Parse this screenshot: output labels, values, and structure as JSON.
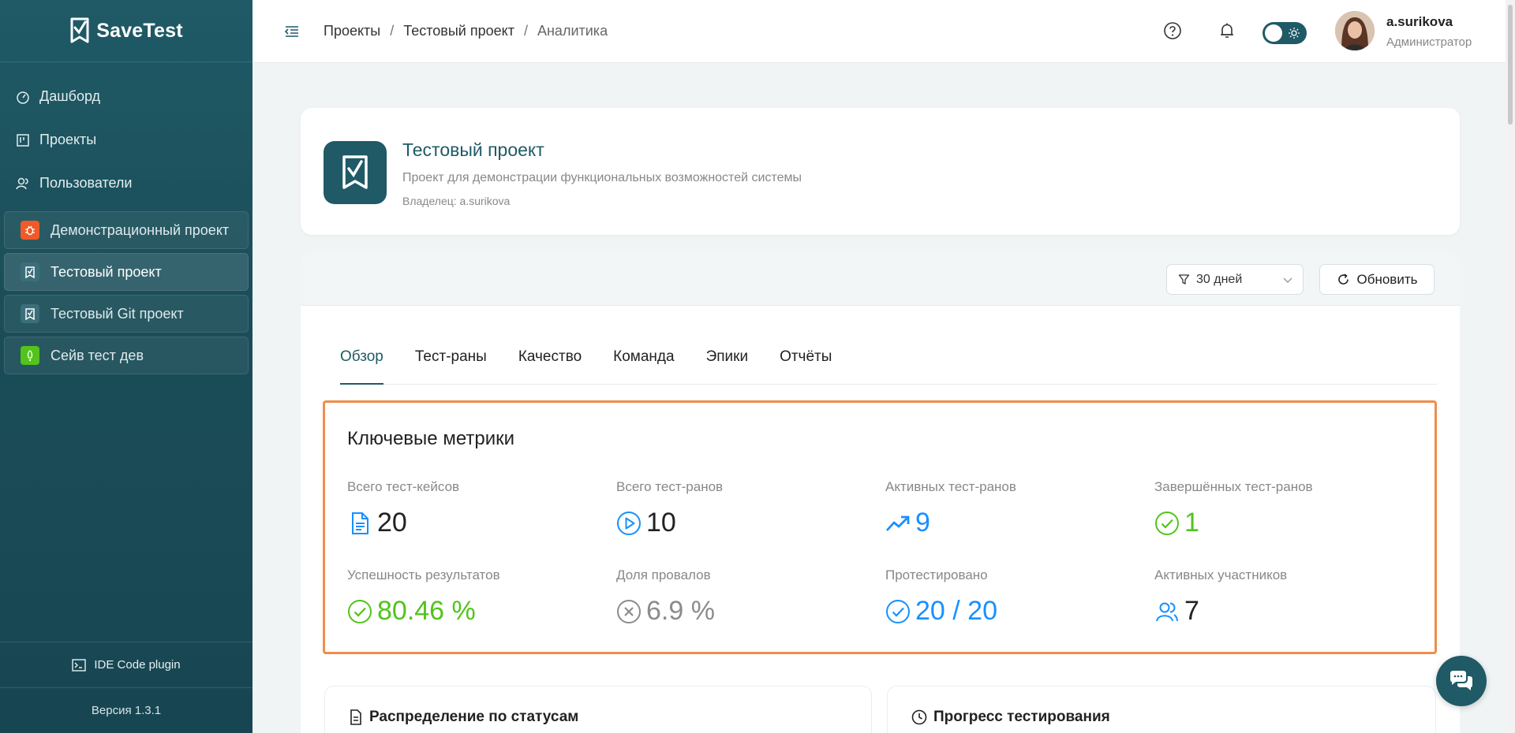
{
  "brand": {
    "name": "SaveTest"
  },
  "sidebar": {
    "nav": [
      {
        "label": "Дашборд",
        "icon": "dashboard-icon"
      },
      {
        "label": "Проекты",
        "icon": "projects-icon"
      },
      {
        "label": "Пользователи",
        "icon": "users-icon"
      }
    ],
    "projects": [
      {
        "label": "Демонстрационный проект",
        "color": "#f05a28"
      },
      {
        "label": "Тестовый проект",
        "color": "#3a6f7a"
      },
      {
        "label": "Тестовый Git проект",
        "color": "#3a6f7a"
      },
      {
        "label": "Сейв тест дев",
        "color": "#52c41a"
      }
    ],
    "ide_plugin": "IDE Code plugin",
    "version": "Версия 1.3.1"
  },
  "header": {
    "breadcrumb": [
      "Проекты",
      "Тестовый проект",
      "Аналитика"
    ],
    "separator": "/",
    "user": {
      "name": "a.surikova",
      "role": "Администратор"
    }
  },
  "project": {
    "title": "Тестовый проект",
    "description": "Проект для демонстрации функциональных возможностей системы",
    "owner": "Владелец: a.surikova"
  },
  "toolbar": {
    "period": "30 дней",
    "refresh": "Обновить"
  },
  "tabs": [
    "Обзор",
    "Тест-раны",
    "Качество",
    "Команда",
    "Эпики",
    "Отчёты"
  ],
  "metrics": {
    "title": "Ключевые метрики",
    "items": [
      {
        "label": "Всего тест-кейсов",
        "value": "20",
        "color": "#222222",
        "icon": "file-icon",
        "icon_color": "#1890ff"
      },
      {
        "label": "Всего тест-ранов",
        "value": "10",
        "color": "#222222",
        "icon": "play-circle-icon",
        "icon_color": "#1890ff"
      },
      {
        "label": "Активных тест-ранов",
        "value": "9",
        "color": "#1890ff",
        "icon": "trend-up-icon",
        "icon_color": "#1890ff"
      },
      {
        "label": "Завершённых тест-ранов",
        "value": "1",
        "color": "#52c41a",
        "icon": "check-circle-icon",
        "icon_color": "#52c41a"
      },
      {
        "label": "Успешность результатов",
        "value": "80.46 %",
        "color": "#52c41a",
        "icon": "check-circle-icon",
        "icon_color": "#52c41a"
      },
      {
        "label": "Доля провалов",
        "value": "6.9 %",
        "color": "#8c8c8c",
        "icon": "close-circle-icon",
        "icon_color": "#8c8c8c"
      },
      {
        "label": "Протестировано",
        "value": "20 / 20",
        "color": "#1890ff",
        "icon": "check-circle-icon",
        "icon_color": "#1890ff"
      },
      {
        "label": "Активных участников",
        "value": "7",
        "color": "#222222",
        "icon": "team-icon",
        "icon_color": "#1890ff"
      }
    ]
  },
  "bottom_cards": [
    {
      "title": "Распределение по статусам",
      "icon": "file-icon"
    },
    {
      "title": "Прогресс тестирования",
      "icon": "clock-icon"
    }
  ]
}
